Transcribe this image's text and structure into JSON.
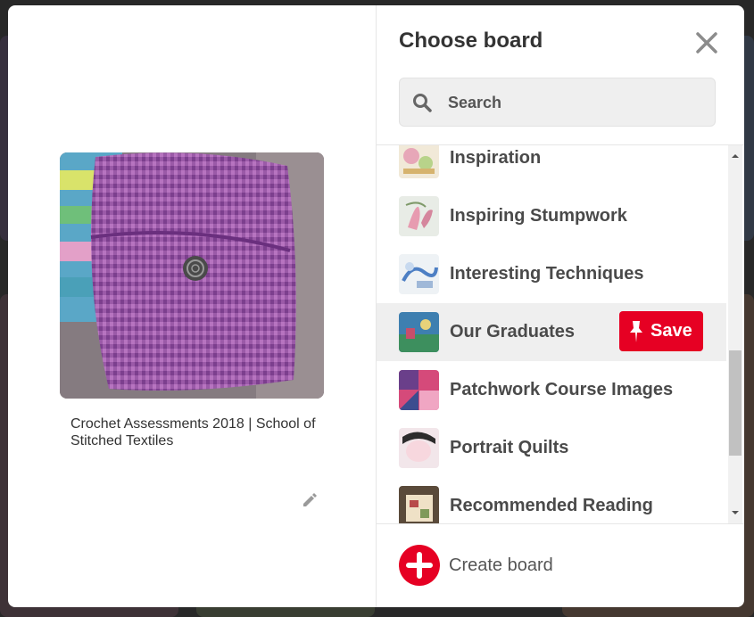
{
  "dialog": {
    "title": "Choose board",
    "search_placeholder": "Search"
  },
  "pin": {
    "description": "Crochet Assessments 2018 | School of Stitched Textiles"
  },
  "boards": [
    {
      "name": "Inspiration"
    },
    {
      "name": "Inspiring Stumpwork"
    },
    {
      "name": "Interesting Techniques"
    },
    {
      "name": "Our Graduates"
    },
    {
      "name": "Patchwork Course Images"
    },
    {
      "name": "Portrait Quilts"
    },
    {
      "name": "Recommended Reading"
    }
  ],
  "save_label": "Save",
  "create_board_label": "Create board",
  "colors": {
    "accent": "#e60023",
    "text": "#333333",
    "hover_row": "#efefef"
  },
  "icons": [
    "close-icon",
    "search-icon",
    "pin-icon",
    "plus-icon",
    "pencil-icon"
  ]
}
